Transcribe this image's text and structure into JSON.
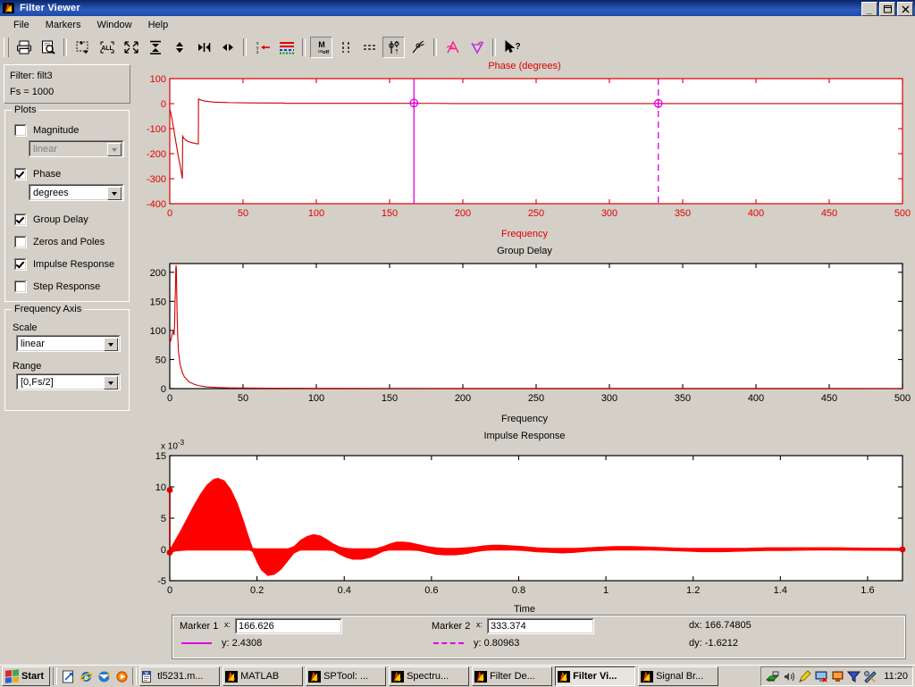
{
  "window": {
    "title": "Filter Viewer",
    "icon": "matlab-icon",
    "buttons": {
      "minimize": "_",
      "maximize": "❐",
      "close": "✕"
    }
  },
  "menubar": {
    "items": [
      "File",
      "Markers",
      "Window",
      "Help"
    ]
  },
  "toolbar": {
    "items": [
      {
        "name": "print-button",
        "icon": "printer-icon"
      },
      {
        "name": "print-preview-button",
        "icon": "print-preview-icon"
      },
      {
        "name": "zoom-in-button",
        "icon": "zoom-rect-icon"
      },
      {
        "name": "zoom-all-button",
        "icon": "zoom-all-icon"
      },
      {
        "name": "zoom-fit-button",
        "icon": "zoom-fit-icon"
      },
      {
        "name": "zoom-y-button",
        "icon": "zoom-vertical-icon"
      },
      {
        "name": "zoom-y-out-button",
        "icon": "zoom-vertical-out-icon"
      },
      {
        "name": "zoom-x-in-button",
        "icon": "zoom-horizontal-in-icon"
      },
      {
        "name": "zoom-x-out-button",
        "icon": "zoom-horizontal-out-icon"
      },
      {
        "name": "axis-scale-button",
        "icon": "axis-arrow-icon"
      },
      {
        "name": "line-style-button",
        "icon": "line-styles-icon"
      },
      {
        "name": "markers-onoff-button",
        "icon": "markers-onoff-icon"
      },
      {
        "name": "vertical-markers-button",
        "icon": "vertical-markers-icon"
      },
      {
        "name": "horizontal-markers-button",
        "icon": "horizontal-markers-icon"
      },
      {
        "name": "track-markers-button",
        "icon": "track-markers-icon"
      },
      {
        "name": "peak-markers-button",
        "icon": "peak-markers-icon"
      },
      {
        "name": "annotate-a-button",
        "icon": "annotate-a-icon"
      },
      {
        "name": "annotate-v-button",
        "icon": "annotate-v-icon"
      },
      {
        "name": "help-pointer-button",
        "icon": "help-pointer-icon"
      }
    ]
  },
  "sidebar": {
    "filter_label": "Filter: filt3",
    "fs_label": "Fs = 1000",
    "plots_group": {
      "title": "Plots",
      "items": [
        {
          "label": "Magnitude",
          "checked": false,
          "combo": {
            "value": "linear",
            "enabled": false
          }
        },
        {
          "label": "Phase",
          "checked": true,
          "combo": {
            "value": "degrees",
            "enabled": true
          }
        },
        {
          "label": "Group Delay",
          "checked": true
        },
        {
          "label": "Zeros and Poles",
          "checked": false
        },
        {
          "label": "Impulse Response",
          "checked": true
        },
        {
          "label": "Step Response",
          "checked": false
        }
      ]
    },
    "frequency_axis_group": {
      "title": "Frequency Axis",
      "scale_label": "Scale",
      "scale_value": "linear",
      "range_label": "Range",
      "range_value": "[0,Fs/2]"
    }
  },
  "markers": {
    "marker1": {
      "label": "Marker 1",
      "x_label": "x:",
      "x_value": "166.626",
      "y_label": "y: 2.4308",
      "style": "solid",
      "color": "#e000e0"
    },
    "marker2": {
      "label": "Marker 2",
      "x_label": "x:",
      "x_value": "333.374",
      "y_label": "y: 0.80963",
      "style": "dashed",
      "color": "#e000e0"
    },
    "dx": "dx: 166.74805",
    "dy": "dy: -1.6212"
  },
  "taskbar": {
    "start": "Start",
    "quick_launch": [
      "show-desktop-icon",
      "internet-explorer-icon",
      "outlook-express-icon",
      "media-player-icon"
    ],
    "buttons": [
      {
        "label": "tl5231.m...",
        "icon": "word-icon",
        "active": false
      },
      {
        "label": "MATLAB",
        "icon": "matlab-icon",
        "active": false
      },
      {
        "label": "SPTool: ...",
        "icon": "matlab-icon",
        "active": false
      },
      {
        "label": "Spectru...",
        "icon": "matlab-icon",
        "active": false
      },
      {
        "label": "Filter De...",
        "icon": "matlab-icon",
        "active": false
      },
      {
        "label": "Filter Vi...",
        "icon": "matlab-icon",
        "active": true
      },
      {
        "label": "Signal Br...",
        "icon": "matlab-icon",
        "active": false
      }
    ],
    "tray_icons": [
      "network-icon",
      "volume-icon",
      "pencil-icon",
      "monitor-icon",
      "display-icon",
      "funnel-icon",
      "tools-icon"
    ],
    "clock": "11:20"
  },
  "chart_data": [
    {
      "type": "line",
      "name": "phase-plot",
      "title": "Phase (degrees)",
      "xlabel": "Frequency",
      "ylabel": "",
      "color": "#cc0000",
      "axis_color": "#e00000",
      "xlim": [
        0,
        500
      ],
      "ylim": [
        -400,
        100
      ],
      "xticks": [
        0,
        50,
        100,
        150,
        200,
        250,
        300,
        350,
        400,
        450,
        500
      ],
      "yticks": [
        -400,
        -300,
        -200,
        -100,
        0,
        100
      ],
      "grid": false,
      "markers": [
        {
          "x": 166.626,
          "y": 2.4308,
          "style": "solid",
          "color": "#e000e0"
        },
        {
          "x": 333.374,
          "y": 0.80963,
          "style": "dashed",
          "color": "#e000e0"
        }
      ],
      "points": [
        [
          0,
          -20
        ],
        [
          1.5,
          -60
        ],
        [
          3.5,
          -130
        ],
        [
          5.5,
          -200
        ],
        [
          7.5,
          -262
        ],
        [
          8.6,
          -300
        ],
        [
          8.8,
          -130
        ],
        [
          10,
          -142
        ],
        [
          12,
          -150
        ],
        [
          15,
          -156
        ],
        [
          18,
          -160
        ],
        [
          19.5,
          -161
        ],
        [
          19.6,
          18
        ],
        [
          21,
          15
        ],
        [
          24,
          10
        ],
        [
          30,
          6
        ],
        [
          40,
          4
        ],
        [
          55,
          3
        ],
        [
          70,
          2.6
        ],
        [
          78,
          2.5
        ],
        [
          79,
          1.2
        ],
        [
          110,
          1.2
        ],
        [
          150,
          1.0
        ],
        [
          180,
          0.9
        ],
        [
          190,
          0.8
        ],
        [
          192,
          0.2
        ],
        [
          260,
          0.2
        ],
        [
          330,
          0.2
        ],
        [
          400,
          0.1
        ],
        [
          460,
          0.1
        ],
        [
          500,
          0.1
        ]
      ]
    },
    {
      "type": "line",
      "name": "group-delay-plot",
      "title": "Group Delay",
      "xlabel": "Frequency",
      "ylabel": "",
      "color": "#cc0000",
      "axis_color": "#000000",
      "xlim": [
        0,
        500
      ],
      "ylim": [
        0,
        215
      ],
      "xticks": [
        0,
        50,
        100,
        150,
        200,
        250,
        300,
        350,
        400,
        450,
        500
      ],
      "yticks": [
        0,
        50,
        100,
        150,
        200
      ],
      "grid": false,
      "points": [
        [
          0,
          78
        ],
        [
          1,
          86
        ],
        [
          1.8,
          96
        ],
        [
          2.4,
          98
        ],
        [
          2.9,
          92
        ],
        [
          3.3,
          110
        ],
        [
          3.6,
          150
        ],
        [
          3.9,
          175
        ],
        [
          4.1,
          205
        ],
        [
          4.3,
          212
        ],
        [
          4.5,
          205
        ],
        [
          4.7,
          172
        ],
        [
          5.0,
          130
        ],
        [
          5.4,
          90
        ],
        [
          6.0,
          62
        ],
        [
          7.0,
          42
        ],
        [
          8.5,
          28
        ],
        [
          10,
          20
        ],
        [
          13,
          12
        ],
        [
          16,
          8
        ],
        [
          20,
          5
        ],
        [
          25,
          3
        ],
        [
          32,
          2
        ],
        [
          40,
          1.3
        ],
        [
          50,
          1.0
        ],
        [
          70,
          0.7
        ],
        [
          100,
          0.5
        ],
        [
          150,
          0.4
        ],
        [
          250,
          0.3
        ],
        [
          350,
          0.25
        ],
        [
          500,
          0.2
        ]
      ]
    },
    {
      "type": "line",
      "name": "impulse-response-plot",
      "title": "Impulse Response",
      "xlabel": "Time",
      "ylabel": "",
      "exponent": "x 10",
      "exponent_power": "-3",
      "color": "#ff0000",
      "axis_color": "#000000",
      "xlim": [
        0,
        1.68
      ],
      "ylim": [
        -5,
        15
      ],
      "xticks": [
        0,
        0.2,
        0.4,
        0.6,
        0.8,
        1,
        1.2,
        1.4,
        1.6
      ],
      "yticks": [
        -5,
        0,
        5,
        10,
        15
      ],
      "grid": false,
      "stem_markers": [
        {
          "x": 0,
          "y": 9.5
        },
        {
          "x": 0,
          "y": -0.5
        },
        {
          "x": 1.68,
          "y": 0.0
        }
      ],
      "envelope": [
        [
          0.0,
          0.0,
          -0.6
        ],
        [
          0.012,
          1.4,
          -0.3
        ],
        [
          0.025,
          3.0,
          -0.2
        ],
        [
          0.04,
          5.0,
          -0.1
        ],
        [
          0.055,
          7.0,
          0.0
        ],
        [
          0.07,
          8.8,
          0.1
        ],
        [
          0.085,
          10.3,
          0.1
        ],
        [
          0.1,
          11.2,
          0.1
        ],
        [
          0.11,
          11.4,
          0.1
        ],
        [
          0.125,
          11.0,
          0.1
        ],
        [
          0.14,
          9.6,
          0.0
        ],
        [
          0.155,
          7.4,
          0.0
        ],
        [
          0.17,
          4.4,
          0.0
        ],
        [
          0.18,
          2.2,
          0.0
        ],
        [
          0.19,
          0.2,
          -0.4
        ],
        [
          0.2,
          0.1,
          -2.0
        ],
        [
          0.21,
          0.1,
          -3.3
        ],
        [
          0.225,
          0.1,
          -4.2
        ],
        [
          0.24,
          0.1,
          -4.0
        ],
        [
          0.255,
          0.1,
          -3.2
        ],
        [
          0.27,
          0.1,
          -1.9
        ],
        [
          0.285,
          0.5,
          -0.6
        ],
        [
          0.3,
          1.5,
          -0.1
        ],
        [
          0.315,
          2.1,
          -0.1
        ],
        [
          0.33,
          2.4,
          -0.1
        ],
        [
          0.345,
          2.2,
          -0.1
        ],
        [
          0.36,
          1.6,
          -0.1
        ],
        [
          0.375,
          0.9,
          -0.2
        ],
        [
          0.39,
          0.4,
          -0.8
        ],
        [
          0.405,
          0.2,
          -1.3
        ],
        [
          0.42,
          0.1,
          -1.6
        ],
        [
          0.44,
          0.1,
          -1.6
        ],
        [
          0.46,
          0.1,
          -1.3
        ],
        [
          0.475,
          0.2,
          -0.8
        ],
        [
          0.49,
          0.5,
          -0.3
        ],
        [
          0.505,
          0.9,
          -0.1
        ],
        [
          0.52,
          1.2,
          -0.1
        ],
        [
          0.535,
          1.2,
          -0.1
        ],
        [
          0.55,
          1.1,
          -0.1
        ],
        [
          0.57,
          0.8,
          -0.2
        ],
        [
          0.59,
          0.5,
          -0.5
        ],
        [
          0.61,
          0.3,
          -0.8
        ],
        [
          0.63,
          0.2,
          -0.9
        ],
        [
          0.655,
          0.2,
          -0.9
        ],
        [
          0.68,
          0.3,
          -0.7
        ],
        [
          0.7,
          0.4,
          -0.4
        ],
        [
          0.72,
          0.6,
          -0.2
        ],
        [
          0.74,
          0.7,
          -0.1
        ],
        [
          0.76,
          0.7,
          -0.1
        ],
        [
          0.785,
          0.6,
          -0.1
        ],
        [
          0.81,
          0.5,
          -0.2
        ],
        [
          0.84,
          0.3,
          -0.4
        ],
        [
          0.87,
          0.2,
          -0.5
        ],
        [
          0.9,
          0.2,
          -0.6
        ],
        [
          0.93,
          0.2,
          -0.5
        ],
        [
          0.96,
          0.3,
          -0.3
        ],
        [
          0.99,
          0.4,
          -0.2
        ],
        [
          1.02,
          0.5,
          -0.1
        ],
        [
          1.06,
          0.5,
          -0.1
        ],
        [
          1.1,
          0.4,
          -0.1
        ],
        [
          1.14,
          0.3,
          -0.2
        ],
        [
          1.18,
          0.2,
          -0.3
        ],
        [
          1.22,
          0.2,
          -0.4
        ],
        [
          1.27,
          0.2,
          -0.4
        ],
        [
          1.32,
          0.2,
          -0.3
        ],
        [
          1.37,
          0.3,
          -0.2
        ],
        [
          1.42,
          0.3,
          -0.2
        ],
        [
          1.47,
          0.3,
          -0.1
        ],
        [
          1.53,
          0.3,
          -0.1
        ],
        [
          1.59,
          0.25,
          -0.15
        ],
        [
          1.68,
          0.2,
          -0.2
        ]
      ]
    }
  ]
}
